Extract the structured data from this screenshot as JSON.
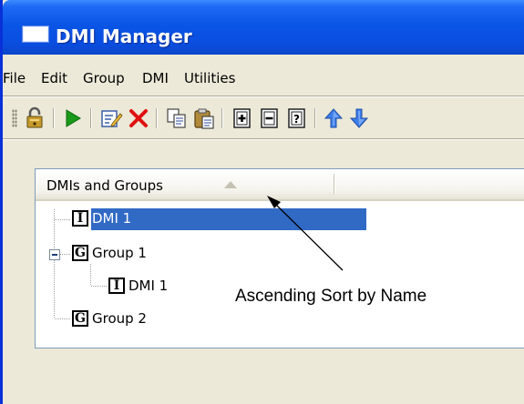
{
  "window": {
    "title": "DMI Manager",
    "title_bar_color": "#0a55e6"
  },
  "menubar": {
    "items": [
      "File",
      "Edit",
      "Group",
      "DMI",
      "Utilities"
    ]
  },
  "toolbar": {
    "buttons": [
      {
        "name": "unlock-icon"
      },
      {
        "name": "run-icon",
        "color": "#1a9a1a"
      },
      {
        "name": "edit-icon"
      },
      {
        "name": "delete-icon",
        "color": "#e01010"
      },
      {
        "name": "copy-icon"
      },
      {
        "name": "paste-icon"
      },
      {
        "name": "add-icon"
      },
      {
        "name": "remove-icon"
      },
      {
        "name": "help-icon"
      },
      {
        "name": "move-up-icon",
        "color": "#3d7ee8"
      },
      {
        "name": "move-down-icon",
        "color": "#3d7ee8"
      }
    ]
  },
  "tree": {
    "column_header": "DMIs and Groups",
    "sort": "ascending",
    "selection_color": "#316ac5",
    "rows": [
      {
        "icon_letter": "I",
        "label": "DMI 1",
        "selected": true
      },
      {
        "icon_letter": "G",
        "label": "Group 1",
        "expanded": true
      },
      {
        "icon_letter": "I",
        "label": "DMI 1"
      },
      {
        "icon_letter": "G",
        "label": "Group 2"
      }
    ]
  },
  "annotation": {
    "text": "Ascending Sort by Name"
  }
}
